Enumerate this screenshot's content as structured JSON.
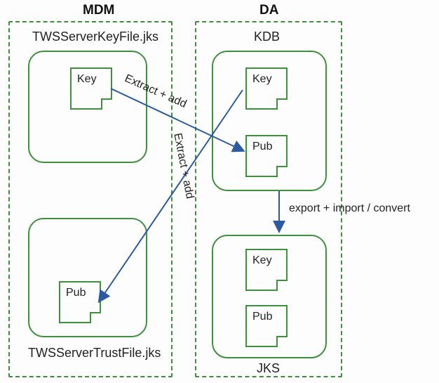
{
  "columns": {
    "left": {
      "title": "MDM"
    },
    "right": {
      "title": "DA"
    }
  },
  "stores": {
    "mdm_key": {
      "label": "TWSServerKeyFile.jks"
    },
    "mdm_trust": {
      "label": "TWSServerTrustFile.jks"
    },
    "da_kdb": {
      "label": "KDB"
    },
    "da_jks": {
      "label": "JKS"
    }
  },
  "docs": {
    "mdm_key_key": {
      "label": "Key"
    },
    "mdm_trust_pub": {
      "label": "Pub"
    },
    "da_kdb_key": {
      "label": "Key"
    },
    "da_kdb_pub": {
      "label": "Pub"
    },
    "da_jks_key": {
      "label": "Key"
    },
    "da_jks_pub": {
      "label": "Pub"
    }
  },
  "edges": {
    "mdm_to_kdb": {
      "label": "Extract + add"
    },
    "kdb_to_trust": {
      "label": "Extract + add"
    },
    "kdb_to_jks": {
      "label": "export + import / convert"
    }
  },
  "chart_data": {
    "type": "diagram",
    "nodes": [
      {
        "id": "MDM",
        "type": "system",
        "children": [
          "TWSServerKeyFile.jks",
          "TWSServerTrustFile.jks"
        ]
      },
      {
        "id": "DA",
        "type": "system",
        "children": [
          "KDB",
          "JKS"
        ]
      },
      {
        "id": "TWSServerKeyFile.jks",
        "type": "keystore",
        "parent": "MDM",
        "entries": [
          "Key"
        ]
      },
      {
        "id": "TWSServerTrustFile.jks",
        "type": "keystore",
        "parent": "MDM",
        "entries": [
          "Pub"
        ]
      },
      {
        "id": "KDB",
        "type": "keystore",
        "parent": "DA",
        "entries": [
          "Key",
          "Pub"
        ]
      },
      {
        "id": "JKS",
        "type": "keystore",
        "parent": "DA",
        "entries": [
          "Key",
          "Pub"
        ]
      }
    ],
    "edges": [
      {
        "from": "TWSServerKeyFile.jks:Key",
        "to": "KDB:Pub",
        "label": "Extract + add"
      },
      {
        "from": "KDB:Key",
        "to": "TWSServerTrustFile.jks:Pub",
        "label": "Extract + add"
      },
      {
        "from": "KDB",
        "to": "JKS",
        "label": "export + import / convert"
      }
    ]
  }
}
